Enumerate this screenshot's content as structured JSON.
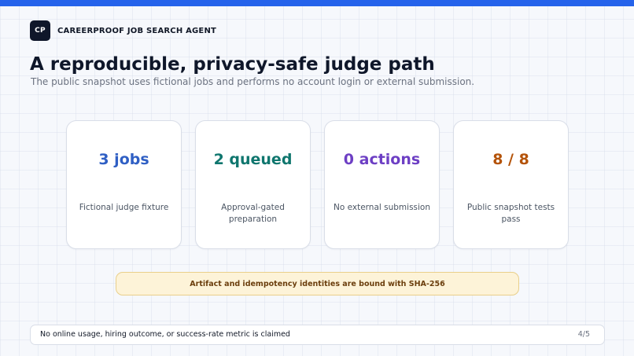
{
  "header": {
    "logo_text": "CP",
    "app_name": "CAREERPROOF JOB SEARCH AGENT"
  },
  "main": {
    "title": "A reproducible, privacy-safe judge path",
    "subtitle": "The public snapshot uses fictional jobs and performs no account login or external submission."
  },
  "cards": [
    {
      "value": "3 jobs",
      "label": "Fictional judge fixture",
      "color": "#2f5fc4"
    },
    {
      "value": "2 queued",
      "label": "Approval-gated preparation",
      "color": "#0f766e"
    },
    {
      "value": "0 actions",
      "label": "No external submission",
      "color": "#6d3fc4"
    },
    {
      "value": "8 / 8",
      "label": "Public snapshot tests pass",
      "color": "#b45309"
    }
  ],
  "banner": {
    "text": "Artifact and idempotency identities are bound with SHA-256"
  },
  "footer": {
    "text": "No online usage, hiring outcome, or success-rate metric is claimed",
    "page": "4/5"
  },
  "colors": {
    "accent_bar": "#2563eb",
    "banner_bg": "#fdf3d8",
    "banner_text": "#6b3e0d"
  }
}
